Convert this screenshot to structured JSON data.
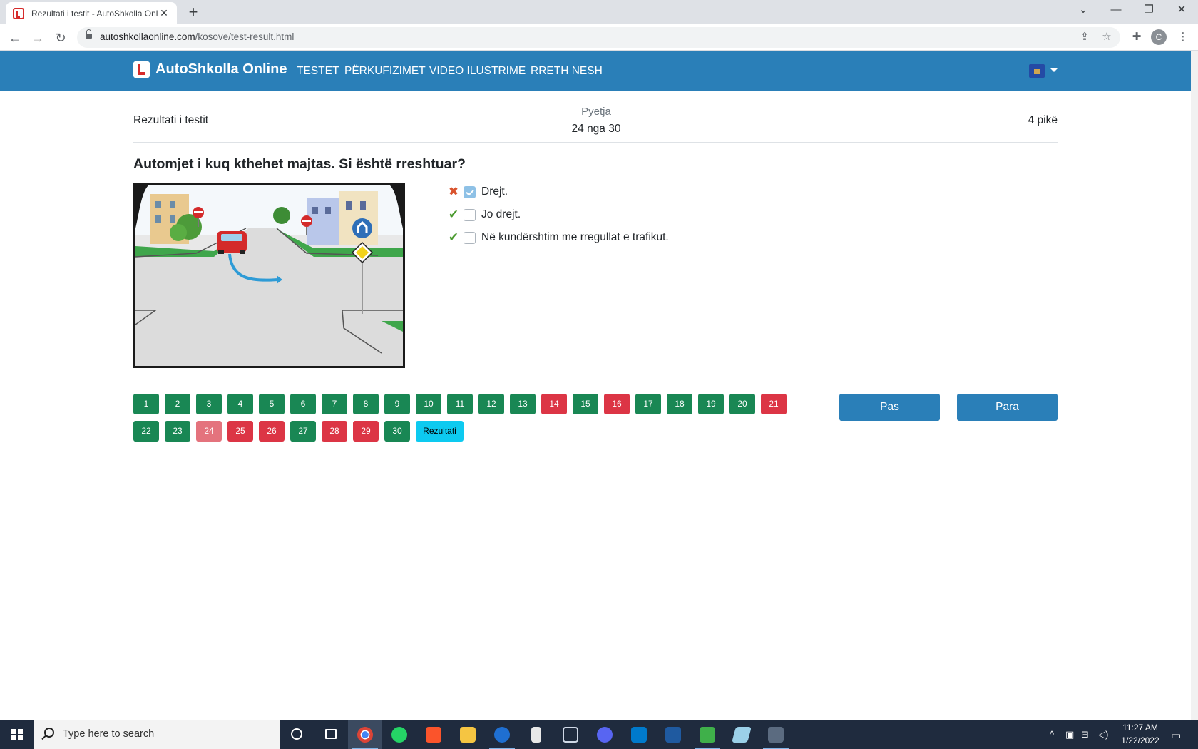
{
  "browser": {
    "tab_title": "Rezultati i testit - AutoShkolla Onl",
    "url_domain": "autoshkollaonline.com",
    "url_path": "/kosove/test-result.html",
    "profile_initial": "C"
  },
  "site": {
    "brand": "AutoShkolla Online",
    "nav": [
      "TESTET",
      "PËRKUFIZIMET",
      "VIDEO ILUSTRIME",
      "RRETH NESH"
    ]
  },
  "result_header": {
    "left": "Rezultati i testit",
    "question_label": "Pyetja",
    "question_progress": "24 nga 30",
    "points": "4 pikë"
  },
  "question": {
    "text": "Automjet i kuq kthehet majtas. Si është rreshtuar?",
    "answers": [
      {
        "label": "Drejt.",
        "checked": true,
        "status": "wrong"
      },
      {
        "label": "Jo drejt.",
        "checked": false,
        "status": "correct"
      },
      {
        "label": "Në kundërshtim me rregullat e trafikut.",
        "checked": false,
        "status": "correct"
      }
    ]
  },
  "question_numbers": [
    {
      "n": "1",
      "state": "correct"
    },
    {
      "n": "2",
      "state": "correct"
    },
    {
      "n": "3",
      "state": "correct"
    },
    {
      "n": "4",
      "state": "correct"
    },
    {
      "n": "5",
      "state": "correct"
    },
    {
      "n": "6",
      "state": "correct"
    },
    {
      "n": "7",
      "state": "correct"
    },
    {
      "n": "8",
      "state": "correct"
    },
    {
      "n": "9",
      "state": "correct"
    },
    {
      "n": "10",
      "state": "correct"
    },
    {
      "n": "11",
      "state": "correct"
    },
    {
      "n": "12",
      "state": "correct"
    },
    {
      "n": "13",
      "state": "correct"
    },
    {
      "n": "14",
      "state": "wrong"
    },
    {
      "n": "15",
      "state": "correct"
    },
    {
      "n": "16",
      "state": "wrong"
    },
    {
      "n": "17",
      "state": "correct"
    },
    {
      "n": "18",
      "state": "correct"
    },
    {
      "n": "19",
      "state": "correct"
    },
    {
      "n": "20",
      "state": "correct"
    },
    {
      "n": "21",
      "state": "wrong"
    },
    {
      "n": "22",
      "state": "correct"
    },
    {
      "n": "23",
      "state": "correct"
    },
    {
      "n": "24",
      "state": "current"
    },
    {
      "n": "25",
      "state": "wrong"
    },
    {
      "n": "26",
      "state": "wrong"
    },
    {
      "n": "27",
      "state": "correct"
    },
    {
      "n": "28",
      "state": "wrong"
    },
    {
      "n": "29",
      "state": "wrong"
    },
    {
      "n": "30",
      "state": "correct"
    }
  ],
  "result_button": "Rezultati",
  "buttons": {
    "prev": "Pas",
    "next": "Para"
  },
  "taskbar": {
    "search_placeholder": "Type here to search",
    "time": "11:27 AM",
    "date": "1/22/2022"
  },
  "colors": {
    "navbar": "#2a7fb8",
    "correct": "#198754",
    "wrong": "#dc3545",
    "current": "#e4737d",
    "result": "#0dcaf0"
  }
}
